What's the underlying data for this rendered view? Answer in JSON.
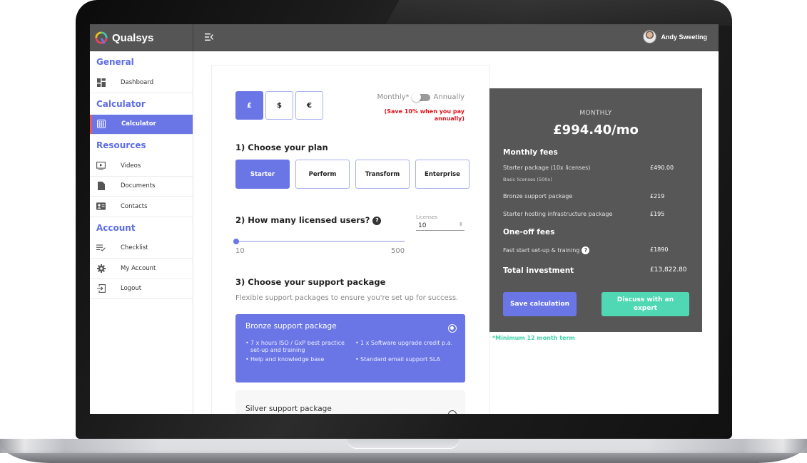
{
  "app": {
    "brand": "Qualsys",
    "logo_colors": [
      "#f2c314",
      "#42c7ae",
      "#e8475b",
      "#6a76e6"
    ],
    "accent_color": "#6a76e6",
    "secondary_accent_color": "#4fd8b3",
    "alert_color": "#e0101a"
  },
  "topbar": {
    "menu_icon": "menu-collapse-icon",
    "user_name": "Andy Sweeting"
  },
  "sidebar": {
    "sections": [
      {
        "title": "General",
        "items": [
          {
            "label": "Dashboard",
            "icon": "dashboard-icon",
            "active": false
          }
        ]
      },
      {
        "title": "Calculator",
        "items": [
          {
            "label": "Calculator",
            "icon": "grid-icon",
            "active": true
          }
        ]
      },
      {
        "title": "Resources",
        "items": [
          {
            "label": "Videos",
            "icon": "video-icon",
            "active": false
          },
          {
            "label": "Documents",
            "icon": "document-icon",
            "active": false
          },
          {
            "label": "Contacts",
            "icon": "contact-card-icon",
            "active": false
          }
        ]
      },
      {
        "title": "Account",
        "items": [
          {
            "label": "Checklist",
            "icon": "checklist-icon",
            "active": false
          },
          {
            "label": "My Account",
            "icon": "gear-icon",
            "active": false
          },
          {
            "label": "Logout",
            "icon": "logout-icon",
            "active": false
          }
        ]
      }
    ]
  },
  "calculator": {
    "currencies": [
      {
        "symbol": "£",
        "active": true
      },
      {
        "symbol": "$",
        "active": false
      },
      {
        "symbol": "€",
        "active": false
      }
    ],
    "billing": {
      "monthly_label": "Monthly*",
      "annually_label": "Annually",
      "annual_selected": false,
      "save_note": "(Save 10% when you pay annually)"
    },
    "step1": {
      "title": "1) Choose your plan",
      "plans": [
        {
          "label": "Starter",
          "active": true
        },
        {
          "label": "Perform",
          "active": false
        },
        {
          "label": "Transform",
          "active": false
        },
        {
          "label": "Enterprise",
          "active": false
        }
      ]
    },
    "step2": {
      "title": "2) How many licensed users?",
      "help_icon": "?",
      "slider_min": "10",
      "slider_max": "500",
      "slider_value": 10,
      "licenses_label": "Licenses",
      "licenses_value": "10"
    },
    "step3": {
      "title": "3) Choose your support package",
      "subtitle": "Flexible support packages to ensure you're set up for success.",
      "packages": [
        {
          "title": "Bronze support package",
          "selected": true,
          "features": [
            "7 x hours ISO / GxP best practice set-up and training",
            "1 x Software upgrade credit p.a.",
            "Help and knowledge base",
            "Standard email support SLA"
          ]
        },
        {
          "title": "Silver support package",
          "selected": false,
          "features": []
        }
      ]
    }
  },
  "summary": {
    "period": "MONTHLY",
    "price": "£994.40/mo",
    "monthly_heading": "Monthly fees",
    "monthly_rows": [
      {
        "label": "Starter package (10x licenses)",
        "amount": "£490.00",
        "sub": "Basic licenses (500x)"
      },
      {
        "label": "Bronze support package",
        "amount": "£219"
      },
      {
        "label": "Starter hosting infrastructure package",
        "amount": "£195"
      }
    ],
    "oneoff_heading": "One-off fees",
    "oneoff_rows": [
      {
        "label": "Fast start set-up & training",
        "amount": "£1890",
        "help": "?"
      }
    ],
    "total_label": "Total investment",
    "total_amount": "£13,822.80",
    "save_button": "Save calculation",
    "expert_button": "Discuss with an expert",
    "footnote": "*Minimum 12 month term"
  }
}
